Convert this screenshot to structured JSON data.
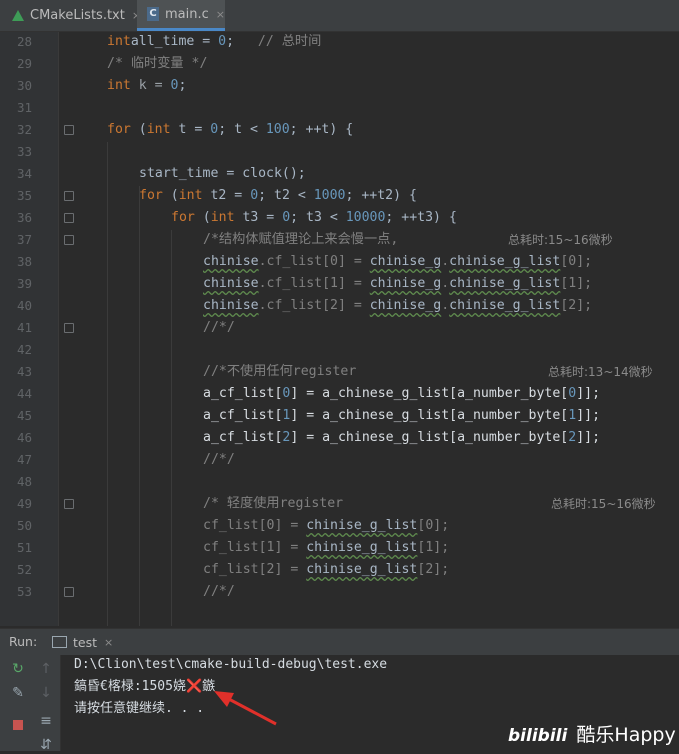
{
  "tabs": [
    {
      "label": "CMakeLists.txt",
      "close": "×"
    },
    {
      "label": "main.c",
      "close": "×"
    }
  ],
  "editor": {
    "lines": [
      {
        "n": "28",
        "tokens": [
          [
            "kw",
            "int"
          ],
          [
            "",
            "all_time = "
          ],
          [
            "num",
            "0"
          ],
          [
            "",
            ";   "
          ],
          [
            "cm",
            "// 总时间"
          ]
        ]
      },
      {
        "n": "29",
        "tokens": [
          [
            "cm",
            "/* 临时变量 */"
          ]
        ]
      },
      {
        "n": "30",
        "tokens": [
          [
            "kw",
            "int"
          ],
          [
            "ug",
            " k = "
          ],
          [
            "num",
            "0"
          ],
          [
            "",
            ";"
          ]
        ]
      },
      {
        "n": "31",
        "tokens": []
      },
      {
        "n": "32",
        "tokens": [
          [
            "kw",
            "for"
          ],
          [
            "",
            " ("
          ],
          [
            "kw",
            "int"
          ],
          [
            "",
            " t = "
          ],
          [
            "num",
            "0"
          ],
          [
            "",
            "; t < "
          ],
          [
            "num",
            "100"
          ],
          [
            "",
            "; ++t) {"
          ]
        ]
      },
      {
        "n": "33",
        "tokens": []
      },
      {
        "n": "34",
        "tokens": [
          [
            "",
            "start_time = clock();"
          ]
        ]
      },
      {
        "n": "35",
        "tokens": [
          [
            "kw",
            "for"
          ],
          [
            "",
            " ("
          ],
          [
            "kw",
            "int"
          ],
          [
            "",
            " t2 = "
          ],
          [
            "num",
            "0"
          ],
          [
            "",
            "; t2 < "
          ],
          [
            "num",
            "1000"
          ],
          [
            "",
            "; ++t2) {"
          ]
        ]
      },
      {
        "n": "36",
        "tokens": [
          [
            "kw",
            "for"
          ],
          [
            "",
            " ("
          ],
          [
            "kw",
            "int"
          ],
          [
            "",
            " t3 = "
          ],
          [
            "num",
            "0"
          ],
          [
            "",
            "; t3 < "
          ],
          [
            "num",
            "10000"
          ],
          [
            "",
            "; ++t3) {"
          ]
        ]
      },
      {
        "n": "37",
        "tokens": [
          [
            "cm",
            "/*结构体赋值理论上来会慢一点,"
          ]
        ]
      },
      {
        "n": "38",
        "tokens": [
          [
            "wv",
            "chinise"
          ],
          [
            "cm",
            ".cf_list[0] = "
          ],
          [
            "wv",
            "chinise_g"
          ],
          [
            "cm",
            "."
          ],
          [
            "wv",
            "chinise_g_list"
          ],
          [
            "cm",
            "[0];"
          ]
        ]
      },
      {
        "n": "39",
        "tokens": [
          [
            "wv",
            "chinise"
          ],
          [
            "cm",
            ".cf_list[1] = "
          ],
          [
            "wv",
            "chinise_g"
          ],
          [
            "cm",
            "."
          ],
          [
            "wv",
            "chinise_g_list"
          ],
          [
            "cm",
            "[1];"
          ]
        ]
      },
      {
        "n": "40",
        "tokens": [
          [
            "wv",
            "chinise"
          ],
          [
            "cm",
            ".cf_list[2] = "
          ],
          [
            "wv",
            "chinise_g"
          ],
          [
            "cm",
            "."
          ],
          [
            "wv",
            "chinise_g_list"
          ],
          [
            "cm",
            "[2];"
          ]
        ]
      },
      {
        "n": "41",
        "tokens": [
          [
            "cm",
            "//*/"
          ]
        ]
      },
      {
        "n": "42",
        "tokens": []
      },
      {
        "n": "43",
        "tokens": [
          [
            "cm",
            "//*不使用任何register"
          ]
        ]
      },
      {
        "n": "44",
        "tokens": [
          [
            "wh",
            "a_cf_list["
          ],
          [
            "num",
            "0"
          ],
          [
            "wh",
            "] = a_chinese_g_list[a_number_byte["
          ],
          [
            "num",
            "0"
          ],
          [
            "wh",
            "]];"
          ]
        ]
      },
      {
        "n": "45",
        "tokens": [
          [
            "wh",
            "a_cf_list["
          ],
          [
            "num",
            "1"
          ],
          [
            "wh",
            "] = a_chinese_g_list[a_number_byte["
          ],
          [
            "num",
            "1"
          ],
          [
            "wh",
            "]];"
          ]
        ]
      },
      {
        "n": "46",
        "tokens": [
          [
            "wh",
            "a_cf_list["
          ],
          [
            "num",
            "2"
          ],
          [
            "wh",
            "] = a_chinese_g_list[a_number_byte["
          ],
          [
            "num",
            "2"
          ],
          [
            "wh",
            "]];"
          ]
        ]
      },
      {
        "n": "47",
        "tokens": [
          [
            "cm",
            "//*/"
          ]
        ]
      },
      {
        "n": "48",
        "tokens": []
      },
      {
        "n": "49",
        "tokens": [
          [
            "cm",
            "/* 轻度使用register"
          ]
        ]
      },
      {
        "n": "50",
        "tokens": [
          [
            "cm",
            "cf_list[0] = "
          ],
          [
            "wv",
            "chinise_g_list"
          ],
          [
            "cm",
            "[0];"
          ]
        ]
      },
      {
        "n": "51",
        "tokens": [
          [
            "cm",
            "cf_list[1] = "
          ],
          [
            "wv",
            "chinise_g_list"
          ],
          [
            "cm",
            "[1];"
          ]
        ]
      },
      {
        "n": "52",
        "tokens": [
          [
            "cm",
            "cf_list[2] = "
          ],
          [
            "wv",
            "chinise_g_list"
          ],
          [
            "cm",
            "[2];"
          ]
        ]
      },
      {
        "n": "53",
        "tokens": [
          [
            "cm",
            "//*/"
          ]
        ]
      }
    ],
    "right_comments": [
      {
        "n": "37",
        "text": "总耗时:15~16微秒"
      },
      {
        "n": "43",
        "text": "总耗时:13~14微秒"
      },
      {
        "n": "49",
        "text": "总耗时:15~16微秒"
      }
    ]
  },
  "run": {
    "label": "Run:",
    "tab": "test",
    "tab_close": "×",
    "console": [
      "D:\\Clion\\test\\cmake-build-debug\\test.exe",
      "鎬昏€楁椂:1505娆❌鏃",
      "请按任意键继续. . ."
    ]
  },
  "watermark": {
    "brand": "bilibili",
    "user": "酷乐Happy"
  },
  "colors": {
    "keyword": "#cc7832",
    "number": "#6897bb",
    "comment": "#808080",
    "arrow": "#e0302a",
    "run_green": "#59a869",
    "stop_red": "#c75450"
  }
}
